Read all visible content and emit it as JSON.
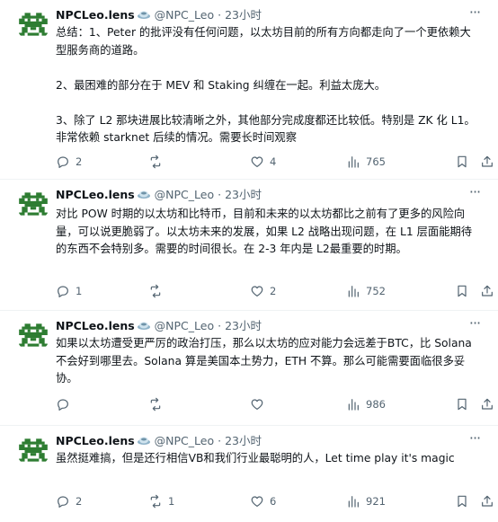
{
  "tweets": [
    {
      "author": "NPCLeo.lens",
      "handle": "@NPC_Leo",
      "dot": "·",
      "time": "23小时",
      "text": "总结：1、Peter 的批评没有任何问题，以太坊目前的所有方向都走向了一个更依赖大型服务商的道路。\n\n2、最困难的部分在于 MEV 和 Staking 纠缠在一起。利益太庞大。\n\n3、除了 L2 那块进展比较清晰之外，其他部分完成度都还比较低。特别是 ZK 化 L1。 非常依赖 starknet 后续的情况。需要长时间观察",
      "replies": "2",
      "retweets": "",
      "likes": "4",
      "views": "765"
    },
    {
      "author": "NPCLeo.lens",
      "handle": "@NPC_Leo",
      "dot": "·",
      "time": "23小时",
      "text": "对比 POW 时期的以太坊和比特币，目前和未来的以太坊都比之前有了更多的风险向量，可以说更脆弱了。以太坊未来的发展，如果 L2 战略出现问题，在 L1 层面能期待的东西不会特别多。需要的时间很长。在 2-3 年内是 L2最重要的时期。",
      "replies": "1",
      "retweets": "",
      "likes": "2",
      "views": "752"
    },
    {
      "author": "NPCLeo.lens",
      "handle": "@NPC_Leo",
      "dot": "·",
      "time": "23小时",
      "text": "如果以太坊遭受更严厉的政治打压，那么以太坊的应对能力会远差于BTC，比 Solana 不会好到哪里去。Solana 算是美国本土势力，ETH 不算。那么可能需要面临很多妥协。",
      "replies": "",
      "retweets": "",
      "likes": "",
      "views": "986"
    },
    {
      "author": "NPCLeo.lens",
      "handle": "@NPC_Leo",
      "dot": "·",
      "time": "23小时",
      "text": "虽然挺难搞，但是还行相信VB和我们行业最聪明的人，Let time play it's magic",
      "replies": "2",
      "retweets": "1",
      "likes": "6",
      "views": "921"
    }
  ],
  "icons": {
    "avatar": "pixel-art-avatar",
    "badge": "lens-emoji",
    "more": "more-icon",
    "reply": "reply-icon",
    "retweet": "retweet-icon",
    "like": "heart-icon",
    "views": "views-icon",
    "bookmark": "bookmark-icon",
    "share": "share-icon"
  },
  "colors": {
    "text": "#0f1419",
    "secondary": "#536471",
    "divider": "#eff3f4",
    "avatar": "#2e7d32"
  }
}
